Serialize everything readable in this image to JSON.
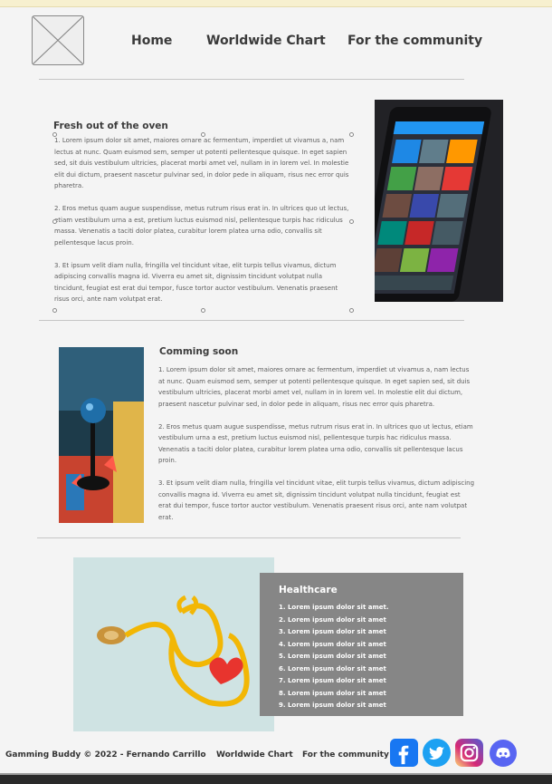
{
  "nav": {
    "home": "Home",
    "chart": "Worldwide Chart",
    "community": "For the community"
  },
  "section1": {
    "title": "Fresh out of the oven",
    "paragraphs": [
      "1. Lorem ipsum dolor sit amet, maiores ornare ac fermentum, imperdiet ut vivamus a, nam lectus at nunc. Quam euismod sem, semper ut potenti pellentesque quisque. In eget sapien sed, sit duis vestibulum ultricies, placerat morbi amet vel, nullam in in lorem vel. In molestie elit dui dictum, praesent nascetur pulvinar sed, in dolor pede in aliquam, risus nec error quis pharetra.",
      "2. Eros metus quam augue suspendisse, metus rutrum risus erat in.  In ultrices quo ut lectus, etiam vestibulum urna a est, pretium luctus euismod nisl, pellentesque turpis hac ridiculus massa. Venenatis a taciti dolor platea, curabitur lorem platea urna odio, convallis sit pellentesque lacus proin.",
      "3. Et ipsum velit diam nulla, fringilla vel tincidunt vitae, elit turpis tellus vivamus, dictum adipiscing convallis magna id. Viverra eu amet sit, dignissim tincidunt volutpat nulla tincidunt, feugiat est erat dui tempor, fusce tortor auctor vestibulum. Venenatis praesent risus orci, ante nam volutpat erat."
    ]
  },
  "section2": {
    "title": "Comming soon",
    "paragraphs": [
      "1. Lorem ipsum dolor sit amet, maiores ornare ac fermentum, imperdiet ut vivamus a, nam lectus at nunc. Quam euismod sem, semper ut potenti pellentesque quisque. In eget sapien sed, sit duis vestibulum ultricies, placerat morbi amet vel, nullam in in lorem vel. In molestie elit dui dictum, praesent nascetur pulvinar sed, in dolor pede in aliquam, risus nec error quis pharetra.",
      "2. Eros metus quam augue suspendisse, metus rutrum risus erat in.  In ultrices quo ut lectus, etiam vestibulum urna a est, pretium luctus euismod nisl, pellentesque turpis hac ridiculus massa. Venenatis a taciti dolor platea, curabitur lorem platea urna odio, convallis sit pellentesque lacus proin.",
      "3. Et ipsum velit diam nulla, fringilla vel tincidunt vitae, elit turpis tellus vivamus, dictum adipiscing convallis magna id. Viverra eu amet sit, dignissim tincidunt volutpat nulla tincidunt, feugiat est erat dui tempor, fusce tortor auctor vestibulum. Venenatis praesent risus orci, ante nam volutpat erat."
    ]
  },
  "healthcare": {
    "title": "Healthcare",
    "items": [
      "1. Lorem ipsum dolor sit amet.",
      "2. Lorem ipsum dolor sit amet",
      "3. Lorem ipsum dolor sit amet",
      "4. Lorem ipsum dolor sit amet",
      "5. Lorem ipsum dolor sit amet",
      "6. Lorem ipsum dolor sit amet",
      "7. Lorem ipsum dolor sit amet",
      "8. Lorem ipsum dolor sit amet",
      "9. Lorem ipsum dolor sit amet"
    ]
  },
  "footer": {
    "copyright": "Gamming Buddy © 2022 - Fernando Carrillo",
    "chart": "Worldwide Chart",
    "community": "For the community",
    "social_icons": [
      "facebook-icon",
      "twitter-icon",
      "instagram-icon",
      "discord-icon"
    ]
  },
  "colors": {
    "background": "#f4f4f4",
    "card": "#868686",
    "facebook": "#1877f2",
    "twitter": "#1da1f2",
    "discord": "#5865f2"
  }
}
